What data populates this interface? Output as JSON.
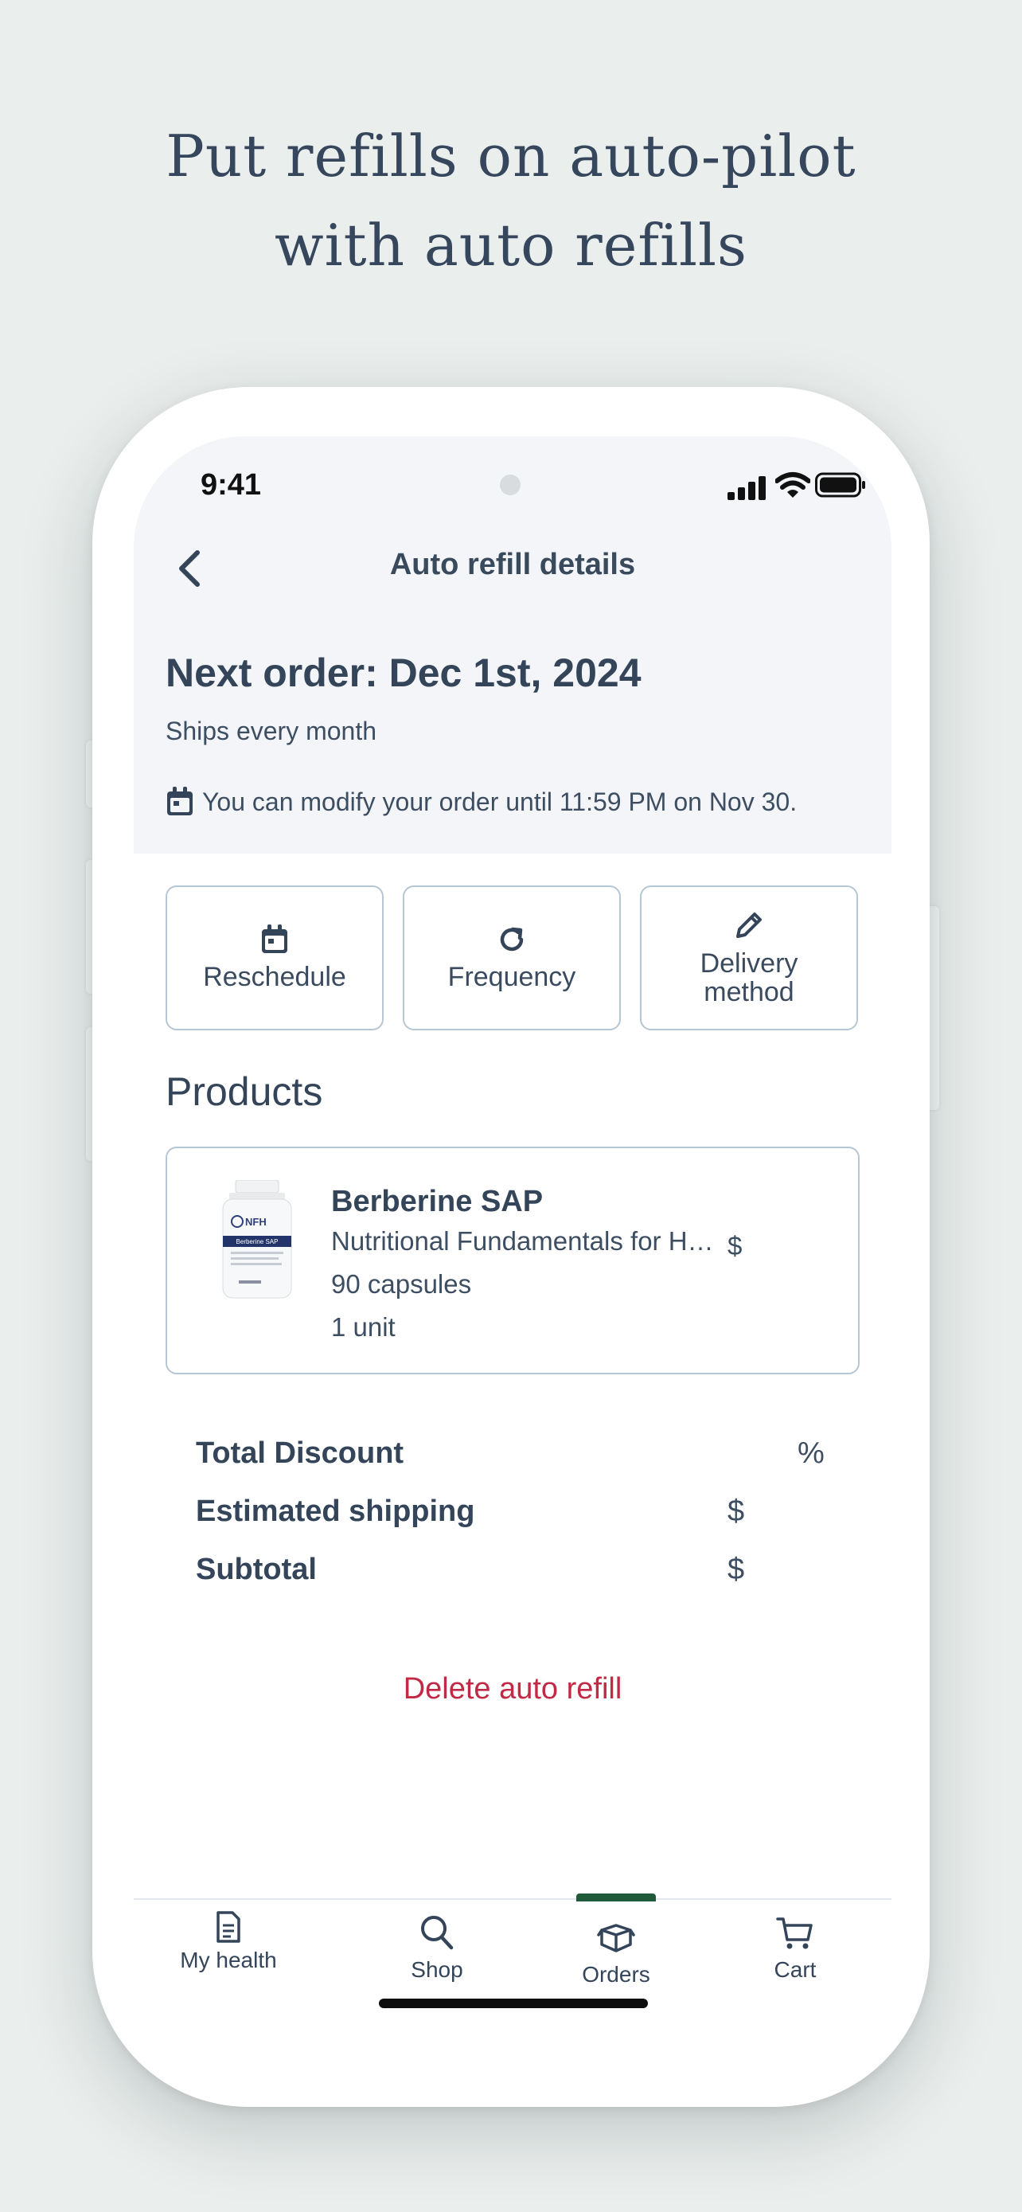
{
  "headline": {
    "line1": "Put refills on auto-pilot",
    "line2": "with auto refills"
  },
  "status_bar": {
    "time": "9:41"
  },
  "header": {
    "title": "Auto refill details"
  },
  "order": {
    "next_order": "Next order: Dec 1st, 2024",
    "frequency_text": "Ships every month",
    "modify_notice": "You can modify your order until 11:59 PM on Nov 30."
  },
  "actions": {
    "reschedule": "Reschedule",
    "frequency": "Frequency",
    "delivery_line1": "Delivery",
    "delivery_line2": "method"
  },
  "products": {
    "heading": "Products",
    "items": [
      {
        "name": "Berberine SAP",
        "brand": "Nutritional Fundamentals for Health",
        "price": "$",
        "size": "90 capsules",
        "quantity": "1 unit",
        "bottle_label_brand": "NFH",
        "bottle_label_name": "Berberine SAP"
      }
    ]
  },
  "summary": {
    "total_discount_label": "Total Discount",
    "total_discount_value": "%",
    "shipping_label": "Estimated shipping",
    "shipping_value": "$",
    "subtotal_label": "Subtotal",
    "subtotal_value": "$"
  },
  "delete_label": "Delete auto refill",
  "tabbar": {
    "active": "Orders",
    "tabs": [
      {
        "label": "My health",
        "icon": "document-icon"
      },
      {
        "label": "Shop",
        "icon": "search-icon"
      },
      {
        "label": "Orders",
        "icon": "box-icon"
      },
      {
        "label": "Cart",
        "icon": "cart-icon"
      }
    ]
  },
  "colors": {
    "background": "#eaeeed",
    "text": "#34455a",
    "border": "#b7c6d4",
    "danger": "#c12944",
    "active_tab": "#1f5a3a"
  }
}
